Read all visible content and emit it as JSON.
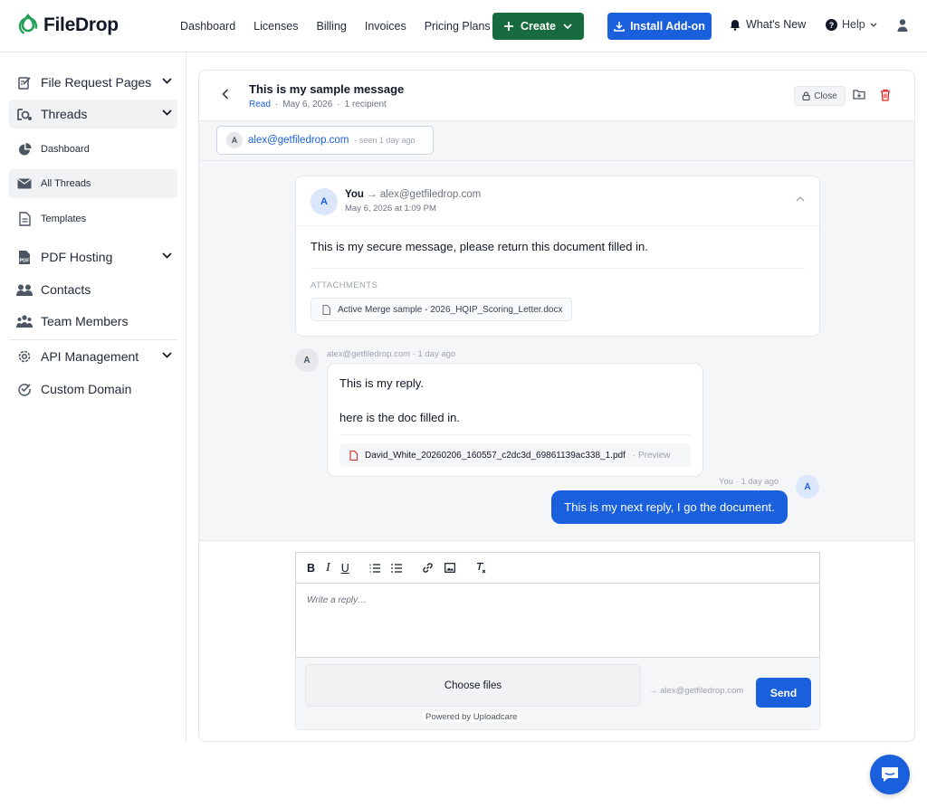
{
  "brand": {
    "name": "FileDrop",
    "accent": "#186a3f",
    "primary": "#1a5fdc"
  },
  "topnav": {
    "links": [
      "Dashboard",
      "Licenses",
      "Billing",
      "Invoices",
      "Pricing Plans"
    ],
    "create_label": "Create",
    "addon_label": "Install Add-on",
    "whats_new": "What's New",
    "help": "Help"
  },
  "sidebar": {
    "items": [
      {
        "label": "File Request Pages",
        "icon": "file-request-icon"
      },
      {
        "label": "Threads",
        "icon": "threads-icon"
      },
      {
        "label": "Dashboard",
        "icon": "pie-chart-icon"
      },
      {
        "label": "All Threads",
        "icon": "envelope-icon"
      },
      {
        "label": "Templates",
        "icon": "document-icon"
      },
      {
        "label": "PDF Hosting",
        "icon": "pdf-icon"
      },
      {
        "label": "Contacts",
        "icon": "contacts-icon"
      },
      {
        "label": "Team Members",
        "icon": "team-icon"
      },
      {
        "label": "API Management",
        "icon": "gear-icon"
      },
      {
        "label": "Custom Domain",
        "icon": "domain-check-icon"
      }
    ]
  },
  "thread": {
    "title": "This is my sample message",
    "status": "Read",
    "date": "May 6, 2026",
    "recipients": "1 recipient",
    "close_label": "Close",
    "recipient_chip": {
      "initial": "A",
      "email": "alex@getfiledrop.com",
      "seen": "· seen 1 day ago"
    }
  },
  "original_message": {
    "initial": "A",
    "from": "You",
    "to": "→ alex@getfiledrop.com",
    "date": "May 6, 2026 at 1:09 PM",
    "body": "This is my secure message, please return this document filled in.",
    "attachments_label": "ATTACHMENTS",
    "attachment": "Active Merge sample - 2026_HQIP_Scoring_Letter.docx"
  },
  "reply": {
    "initial": "A",
    "meta": "alex@getfiledrop.com · 1 day ago",
    "line1": "This is my reply.",
    "line2": "here is the doc filled in.",
    "attachment": "David_White_20260206_160557_c2dc3d_69861139ac338_1.pdf",
    "preview": "· Preview"
  },
  "my_reply": {
    "meta": "You · 1 day ago",
    "initial": "A",
    "body": "This is my next reply, I go the document."
  },
  "composer": {
    "placeholder": "Write a reply…",
    "choose_files": "Choose files",
    "powered_by": "Powered by Uploadcare",
    "to": "→ alex@getfiledrop.com",
    "send": "Send"
  }
}
